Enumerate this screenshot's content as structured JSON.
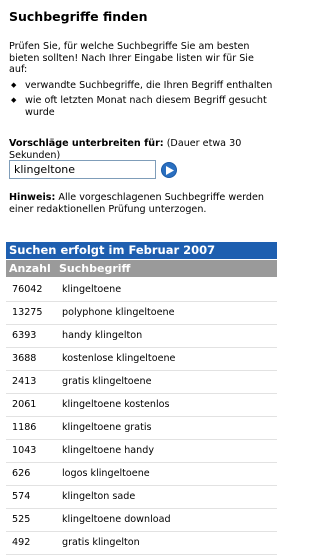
{
  "title": "Suchbegriffe finden",
  "intro": {
    "text": "Prüfen Sie, für welche Suchbegriffe Sie am besten bieten sollten! Nach Ihrer Eingabe listen wir für Sie auf:",
    "bullets": [
      "verwandte Suchbegriffe, die Ihren Begriff enthalten",
      "wie oft letzten Monat nach diesem Begriff gesucht wurde"
    ]
  },
  "suggest": {
    "label": "Vorschläge unterbreiten für:",
    "duration": " (Dauer etwa 30 Sekunden)",
    "input_value": "klingeltone"
  },
  "hint": {
    "label": "Hinweis:",
    "text": " Alle vorgeschlagenen Suchbegriffe werden einer redaktionellen Prüfung unterzogen."
  },
  "results": {
    "header": "Suchen erfolgt im Februar 2007",
    "col_count": "Anzahl",
    "col_term": "Suchbegriff",
    "rows": [
      {
        "count": "76042",
        "term": "klingeltoene"
      },
      {
        "count": "13275",
        "term": "polyphone klingeltoene"
      },
      {
        "count": "6393",
        "term": "handy klingelton"
      },
      {
        "count": "3688",
        "term": "kostenlose klingeltoene"
      },
      {
        "count": "2413",
        "term": "gratis klingeltoene"
      },
      {
        "count": "2061",
        "term": "klingeltoene kostenlos"
      },
      {
        "count": "1186",
        "term": "klingeltoene gratis"
      },
      {
        "count": "1043",
        "term": "klingeltoene handy"
      },
      {
        "count": "626",
        "term": "logos klingeltoene"
      },
      {
        "count": "574",
        "term": "klingelton sade"
      },
      {
        "count": "525",
        "term": "klingeltoene download"
      },
      {
        "count": "492",
        "term": "gratis klingelton"
      }
    ]
  },
  "colors": {
    "header_blue": "#1e5fb0",
    "column_header_gray": "#9a9a9a"
  },
  "icons": {
    "go_button": "arrow-right-circle-icon",
    "bullet": "diamond-bullet-icon"
  }
}
